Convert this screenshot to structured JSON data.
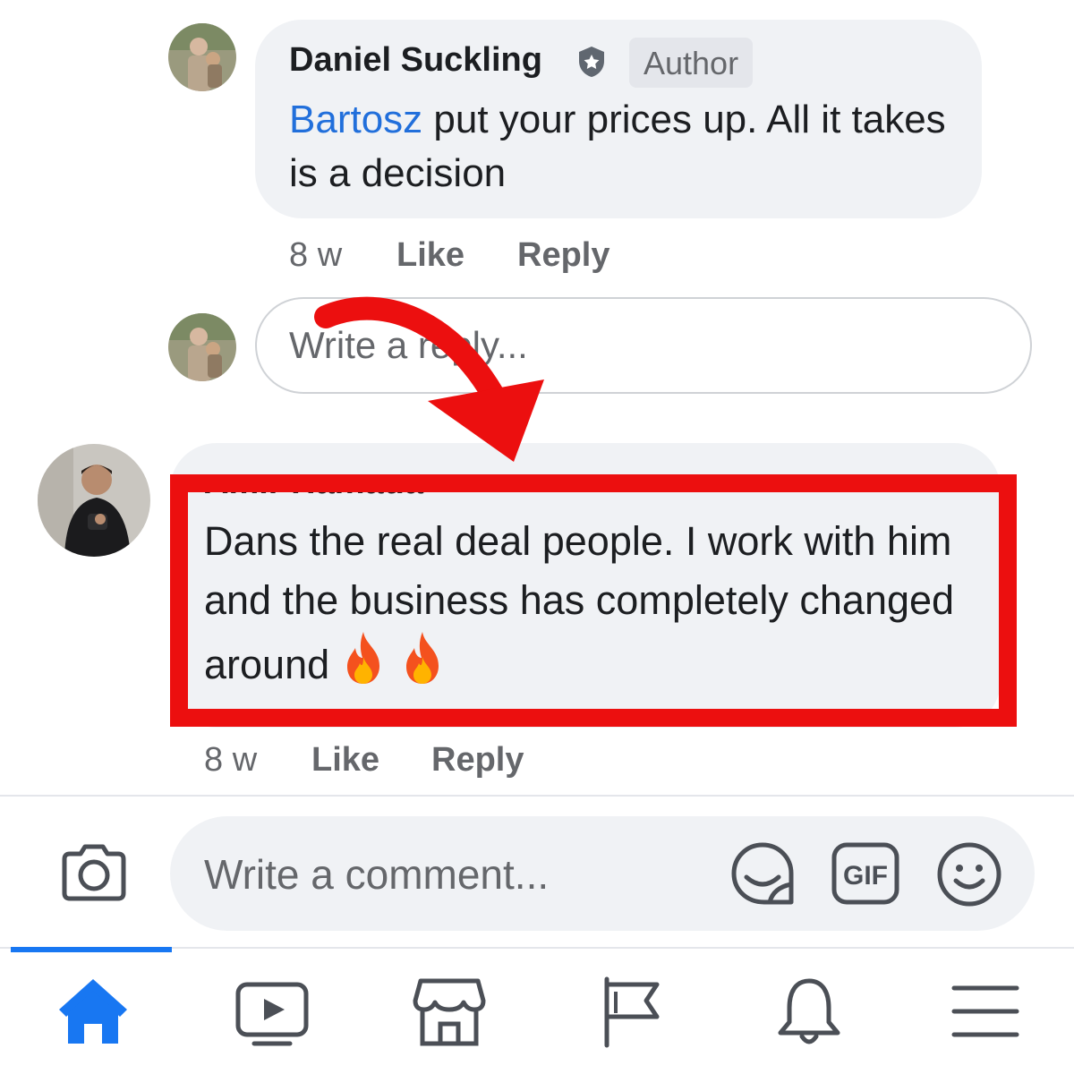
{
  "thread": {
    "comments": [
      {
        "author": "Daniel Suckling",
        "badge": "Author",
        "mention": "Bartosz",
        "text": "put your prices up. All it takes is a decision",
        "time": "8 w",
        "like_label": "Like",
        "reply_label": "Reply"
      },
      {
        "author": "Amir Hamada",
        "text": "Dans the real deal people. I work with him and the business has completely changed around",
        "emoji": "🔥🔥",
        "time": "8 w",
        "like_label": "Like",
        "reply_label": "Reply"
      }
    ],
    "reply_input": {
      "placeholder": "Write a reply..."
    }
  },
  "composer": {
    "placeholder": "Write a comment...",
    "gif_label": "GIF",
    "icons": [
      "camera-icon",
      "sticker-icon",
      "gif-icon",
      "emoji-icon"
    ]
  },
  "bottom_nav": {
    "items": [
      {
        "icon": "home-icon",
        "active": true
      },
      {
        "icon": "watch-icon",
        "active": false
      },
      {
        "icon": "marketplace-icon",
        "active": false
      },
      {
        "icon": "pages-flag-icon",
        "active": false
      },
      {
        "icon": "notifications-bell-icon",
        "active": false
      },
      {
        "icon": "menu-icon",
        "active": false
      }
    ]
  },
  "colors": {
    "accent": "#1877f2",
    "mention": "#216fdb",
    "highlight": "#ec0f0f",
    "bubble": "#f0f2f5",
    "secondary_text": "#65676b"
  }
}
